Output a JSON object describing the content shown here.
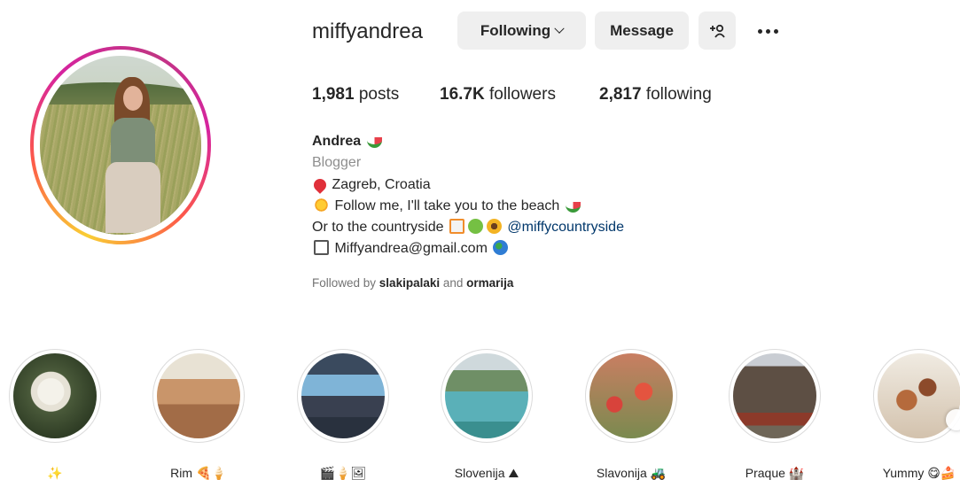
{
  "profile": {
    "username": "miffyandrea",
    "following_button": "Following",
    "message_button": "Message",
    "add_user_icon": "+(person)",
    "stats": {
      "posts_count": "1,981",
      "posts_label": " posts",
      "followers_count": "16.7K",
      "followers_label": " followers",
      "following_count": "2,817",
      "following_label": " following"
    },
    "bio": {
      "name": "Andrea",
      "category": "Blogger",
      "line1": "Zagreb, Croatia",
      "line2": "Follow me, I'll take you to the beach",
      "line3_text": "Or to the countryside",
      "line3_link": "@miffycountryside",
      "line4": "Miffyandrea@gmail.com"
    },
    "followed_by": {
      "prefix": "Followed by ",
      "user1": "slakipalaki",
      "conjunction": " and ",
      "user2": "ormarija"
    }
  },
  "highlights": [
    {
      "label": "✨"
    },
    {
      "label": "Rim 🍕🍦"
    },
    {
      "label": "🎬🍦🖼"
    },
    {
      "label": "Slovenija ⛰"
    },
    {
      "label": "Slavonija 🚜"
    },
    {
      "label": "Praque 🏰"
    },
    {
      "label": "Yummy 😋🍰"
    }
  ],
  "colors": {
    "button_bg": "#efefef",
    "link": "#00376b",
    "secondary_text": "#8e8e8e"
  }
}
